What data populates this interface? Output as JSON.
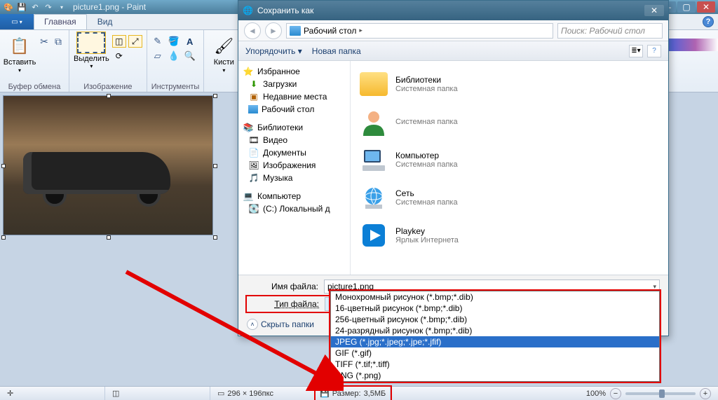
{
  "titlebar": {
    "filename": "picture1.png",
    "appname": "Paint"
  },
  "tabs": {
    "file_dd": "▾",
    "home": "Главная",
    "view": "Вид"
  },
  "ribbon": {
    "clipboard": {
      "paste": "Вставить",
      "label": "Буфер обмена"
    },
    "image": {
      "select": "Выделить",
      "label": "Изображение"
    },
    "tools": {
      "label": "Инструменты"
    },
    "brushes": {
      "label": "Кисти"
    }
  },
  "status": {
    "dims": "296 × 196пкс",
    "size_label": "Размер:",
    "size_value": "3,5МБ",
    "zoom": "100%"
  },
  "dialog": {
    "title": "Сохранить как",
    "breadcrumb": "Рабочий стол",
    "search_placeholder": "Поиск: Рабочий стол",
    "toolbar": {
      "organize": "Упорядочить",
      "newfolder": "Новая папка"
    },
    "tree": {
      "favorites": "Избранное",
      "downloads": "Загрузки",
      "recent": "Недавние места",
      "desktop": "Рабочий стол",
      "libraries": "Библиотеки",
      "videos": "Видео",
      "documents": "Документы",
      "pictures": "Изображения",
      "music": "Музыка",
      "computer": "Компьютер",
      "cdrive": "(C:) Локальный д"
    },
    "content": {
      "libraries": {
        "name": "Библиотеки",
        "sub": "Системная папка"
      },
      "user": {
        "name": "",
        "sub": "Системная папка"
      },
      "computer": {
        "name": "Компьютер",
        "sub": "Системная папка"
      },
      "network": {
        "name": "Сеть",
        "sub": "Системная папка"
      },
      "playkey": {
        "name": "Playkey",
        "sub": "Ярлык Интернета"
      }
    },
    "filename_label": "Имя файла:",
    "filename_value": "picture1.png",
    "filetype_label": "Тип файла:",
    "filetype_value": "PNG (*.png)",
    "hide_folders": "Скрыть папки",
    "types": [
      "Монохромный рисунок (*.bmp;*.dib)",
      "16-цветный рисунок (*.bmp;*.dib)",
      "256-цветный рисунок (*.bmp;*.dib)",
      "24-разрядный рисунок (*.bmp;*.dib)",
      "JPEG (*.jpg;*.jpeg;*.jpe;*.jfif)",
      "GIF (*.gif)",
      "TIFF (*.tif;*.tiff)",
      "PNG (*.png)"
    ]
  }
}
